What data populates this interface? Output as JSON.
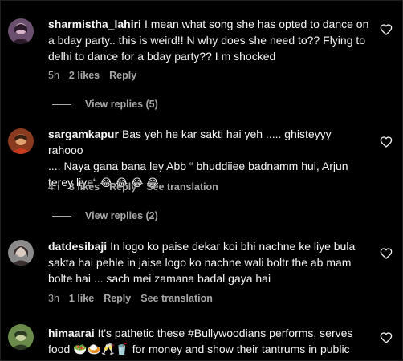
{
  "comments": [
    {
      "username": "sharmistha_lahiri",
      "text_lines": [
        "I mean what song she has opted to dance on",
        "a bday party.. this is weird!! N why does she need to?? Flying to",
        "delhi to dance for a bday party?? I m shocked"
      ],
      "time": "5h",
      "likes": "2 likes",
      "reply_label": "Reply",
      "see_translation": "",
      "view_replies": "View replies (5)",
      "avatar_colors": [
        "#6b4f6e",
        "#d8b4c8",
        "#2a1a2a"
      ]
    },
    {
      "username": "sargamkapur",
      "text_lines": [
        "Bas yeh he kar sakti hai yeh ..... ghisteyyy rahooo",
        ".... Naya gana bana ley Abb “ bhuddiiee badnamm hui, Arjun",
        "terey liye“ "
      ],
      "emojis": "😂 😂 😂 😂",
      "time": "4h",
      "likes": "3 likes",
      "reply_label": "Reply",
      "see_translation": "See translation",
      "view_replies": "View replies (2)",
      "avatar_colors": [
        "#8a3a1e",
        "#e0a070",
        "#3a2010"
      ]
    },
    {
      "username": "datdesibaji",
      "text_lines": [
        "In logo ko paise dekar koi bhi nachne ke liye bula",
        "sakta hai pehle in jaise logo ko nachne wali boltr the ab mam",
        "bolte hai ... sach mei zamana badal gaya hai"
      ],
      "time": "3h",
      "likes": "1 like",
      "reply_label": "Reply",
      "see_translation": "See translation",
      "view_replies": "",
      "avatar_colors": [
        "#8a8a8a",
        "#d9cbc0",
        "#3a3030"
      ]
    },
    {
      "username": "himaarai",
      "text_lines": [
        "It's pathetic these #Bullywoodians performs, serves",
        "food 🥗🍛🥂🥤 for money and show their tantrums in public"
      ],
      "time": "",
      "likes": "",
      "reply_label": "",
      "see_translation": "",
      "view_replies": "",
      "avatar_colors": [
        "#6a8a4a",
        "#c8d0a0",
        "#2a3a20"
      ]
    }
  ]
}
